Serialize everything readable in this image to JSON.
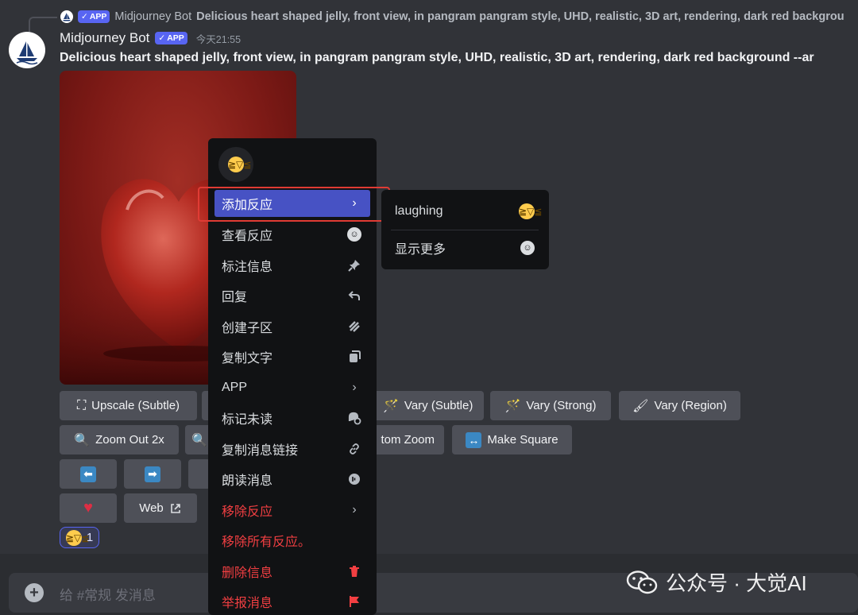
{
  "reply": {
    "author": "Midjourney Bot",
    "badge": "APP",
    "text": "Delicious heart shaped jelly, front view, in pangram pangram style, UHD, realistic, 3D art, rendering, dark red backgrou"
  },
  "message": {
    "author": "Midjourney Bot",
    "badge": "APP",
    "timestamp": "今天21:55",
    "prompt": "Delicious heart shaped jelly, front view, in pangram pangram style, UHD, realistic, 3D art, rendering, dark red background --ar"
  },
  "buttons": {
    "upscale_subtle": "Upscale (Subtle)",
    "vary_subtle": "Vary (Subtle)",
    "vary_strong": "Vary (Strong)",
    "vary_region": "Vary (Region)",
    "zoom_out_2x": "Zoom Out 2x",
    "custom_zoom": "tom Zoom",
    "make_square": "Make Square",
    "web": "Web"
  },
  "reaction": {
    "emoji": "laughing-emoji",
    "count": "1"
  },
  "composer": {
    "placeholder": "给 #常规 发消息"
  },
  "watermark": {
    "text": "公众号 · 大觉AI"
  },
  "context_menu": {
    "items": [
      {
        "label": "添加反应",
        "icon": "chevron-right-icon"
      },
      {
        "label": "查看反应",
        "icon": "smile-icon"
      },
      {
        "label": "标注信息",
        "icon": "pin-icon"
      },
      {
        "label": "回复",
        "icon": "reply-icon"
      },
      {
        "label": "创建子区",
        "icon": "thread-icon"
      },
      {
        "label": "复制文字",
        "icon": "copy-icon"
      },
      {
        "label": "APP",
        "icon": "chevron-right-icon"
      },
      {
        "label": "标记未读",
        "icon": "mark-unread-icon"
      },
      {
        "label": "复制消息链接",
        "icon": "link-icon"
      },
      {
        "label": "朗读消息",
        "icon": "speak-icon"
      },
      {
        "label": "移除反应",
        "icon": "chevron-right-icon"
      },
      {
        "label": "移除所有反应。",
        "icon": ""
      },
      {
        "label": "删除信息",
        "icon": "trash-icon"
      },
      {
        "label": "举报消息",
        "icon": "flag-icon"
      }
    ]
  },
  "submenu": {
    "items": [
      {
        "label": "laughing",
        "icon": "laughing-emoji"
      },
      {
        "label": "显示更多",
        "icon": "smile-icon"
      }
    ]
  },
  "colors": {
    "accent": "#5865f2",
    "danger": "#f23f42",
    "highlight": "#e03b34"
  }
}
